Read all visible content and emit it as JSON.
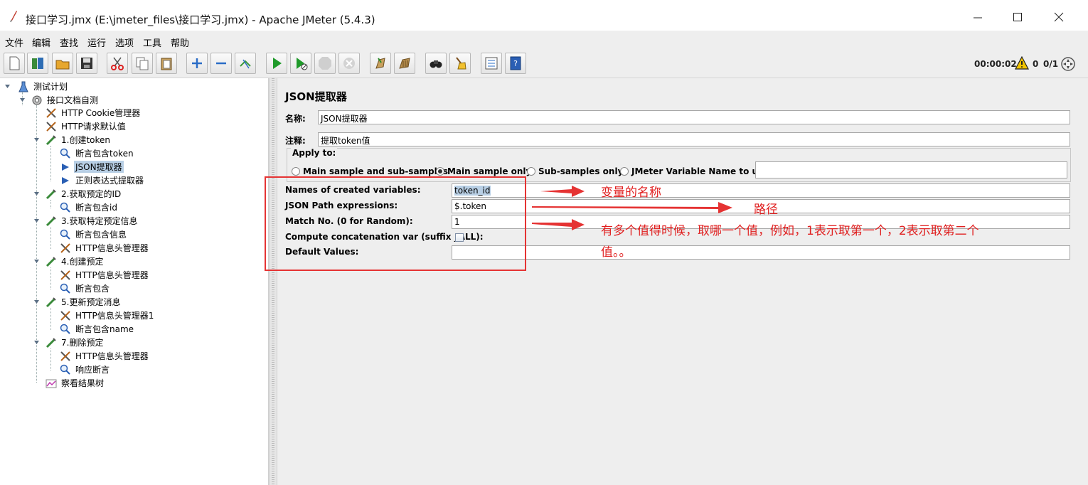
{
  "window": {
    "title": "接口学习.jmx (E:\\jmeter_files\\接口学习.jmx) - Apache JMeter (5.4.3)"
  },
  "menu": [
    "文件",
    "编辑",
    "查找",
    "运行",
    "选项",
    "工具",
    "帮助"
  ],
  "toolbar": {
    "buttons": [
      "new-icon",
      "templates-icon",
      "open-icon",
      "save-icon",
      "cut-icon",
      "copy-icon",
      "paste-icon",
      "expand-icon",
      "collapse-icon",
      "toggle-icon",
      "start-icon",
      "start-no-pause-icon",
      "stop-icon",
      "shutdown-icon",
      "clear-icon",
      "clear-all-icon",
      "search-icon",
      "reset-search-icon",
      "function-helper-icon",
      "help-icon"
    ],
    "elapsed_time": "00:00:02",
    "error_count": "0",
    "active_threads": "0/1"
  },
  "tree": [
    {
      "label": "测试计划",
      "icon": "test-plan-icon"
    },
    {
      "label": "接口文档自测",
      "icon": "thread-group-icon"
    },
    {
      "label": "HTTP Cookie管理器",
      "icon": "config-tool-icon"
    },
    {
      "label": "HTTP请求默认值",
      "icon": "config-tool-icon"
    },
    {
      "label": "1.创建token",
      "icon": "sampler-icon"
    },
    {
      "label": "断言包含token",
      "icon": "assertion-icon"
    },
    {
      "label": "JSON提取器",
      "icon": "extractor-icon",
      "selected": true
    },
    {
      "label": "正则表达式提取器",
      "icon": "extractor-icon"
    },
    {
      "label": "2.获取预定的ID",
      "icon": "sampler-icon"
    },
    {
      "label": "断言包含id",
      "icon": "assertion-icon"
    },
    {
      "label": "3.获取特定预定信息",
      "icon": "sampler-icon"
    },
    {
      "label": "断言包含信息",
      "icon": "assertion-icon"
    },
    {
      "label": "HTTP信息头管理器",
      "icon": "config-tool-icon"
    },
    {
      "label": "4.创建预定",
      "icon": "sampler-icon"
    },
    {
      "label": "HTTP信息头管理器",
      "icon": "config-tool-icon"
    },
    {
      "label": "断言包含",
      "icon": "assertion-icon"
    },
    {
      "label": "5.更新预定消息",
      "icon": "sampler-icon"
    },
    {
      "label": "HTTP信息头管理器1",
      "icon": "config-tool-icon"
    },
    {
      "label": "断言包含name",
      "icon": "assertion-icon"
    },
    {
      "label": "7.删除预定",
      "icon": "sampler-icon"
    },
    {
      "label": "HTTP信息头管理器",
      "icon": "config-tool-icon"
    },
    {
      "label": "响应断言",
      "icon": "assertion-icon"
    },
    {
      "label": "察看结果树",
      "icon": "listener-icon"
    }
  ],
  "panel": {
    "title": "JSON提取器",
    "name_label": "名称:",
    "name_value": "JSON提取器",
    "comment_label": "注释:",
    "comment_value": "提取token值",
    "apply_to_legend": "Apply to:",
    "apply_options": [
      "Main sample and sub-samples",
      "Main sample only",
      "Sub-samples only",
      "JMeter Variable Name to use"
    ],
    "apply_selected": "Main sample only",
    "variable_name_value": "",
    "fields": [
      {
        "label": "Names of created variables:",
        "value": "token_id"
      },
      {
        "label": "JSON Path expressions:",
        "value": "$.token"
      },
      {
        "label": "Match No. (0 for Random):",
        "value": "1"
      },
      {
        "label": "Compute concatenation var (suffix _ALL):",
        "checked": false
      },
      {
        "label": "Default Values:",
        "value": ""
      }
    ]
  },
  "annotations": {
    "note1": "变量的名称",
    "note2": "路径",
    "note3_line1": "有多个值得时候，取哪一个值，例如，1表示取第一个，2表示取第二个",
    "note3_line2": "值。。",
    "color": "#e02020"
  }
}
